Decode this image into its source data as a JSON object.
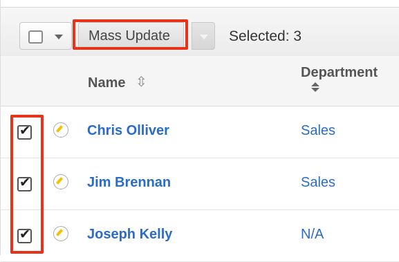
{
  "toolbar": {
    "mass_update_label": "Mass Update",
    "selected_text": "Selected: 3"
  },
  "columns": {
    "name": "Name",
    "department": "Department"
  },
  "rows": [
    {
      "name": "Chris Olliver",
      "department": "Sales",
      "checked": true
    },
    {
      "name": "Jim Brennan",
      "department": "Sales",
      "checked": true
    },
    {
      "name": "Joseph Kelly",
      "department": "N/A",
      "checked": true
    }
  ],
  "colors": {
    "highlight": "#e8331b",
    "link": "#2a6cc7"
  },
  "icons": {
    "checkbox": "checkbox-icon",
    "dropdown": "chevron-down-icon",
    "sort": "sort-icon",
    "edit": "pencil-icon",
    "check": "check-icon"
  }
}
